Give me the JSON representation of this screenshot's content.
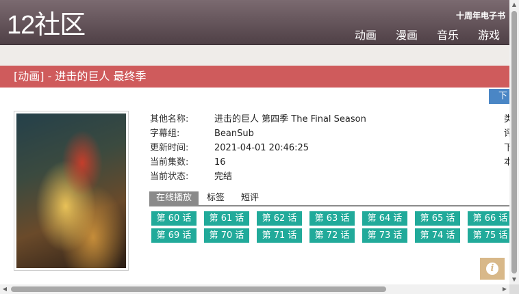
{
  "header": {
    "logo_num": "12",
    "logo_text": "社区",
    "anniversary": "十周年电子书",
    "nav": [
      "动画",
      "漫画",
      "音乐",
      "游戏"
    ]
  },
  "title_bar": "[动画] - 进击的巨人 最终季",
  "download_label": "下载",
  "info": [
    {
      "label": "其他名称:",
      "value": "进击的巨人 第四季 The Final Season"
    },
    {
      "label": "字幕组:",
      "value": "BeanSub"
    },
    {
      "label": "更新时间:",
      "value": "2021-04-01 20:46:25"
    },
    {
      "label": "当前集数:",
      "value": "16"
    },
    {
      "label": "当前状态:",
      "value": "完结"
    }
  ],
  "right_col": [
    "类",
    "评",
    "下",
    "本"
  ],
  "tabs": [
    "在线播放",
    "标签",
    "短评"
  ],
  "episodes": [
    "第 60 话",
    "第 61 话",
    "第 62 话",
    "第 63 话",
    "第 64 话",
    "第 65 话",
    "第 66 话",
    "第 69 话",
    "第 70 话",
    "第 71 话",
    "第 72 话",
    "第 73 话",
    "第 74 话",
    "第 75 话"
  ],
  "colors": {
    "header": "#5e4e54",
    "title_bar": "#cf5b5c",
    "episode_button": "#21aa9a",
    "download_tab": "#4a86c5",
    "info_button": "#d8b889"
  }
}
